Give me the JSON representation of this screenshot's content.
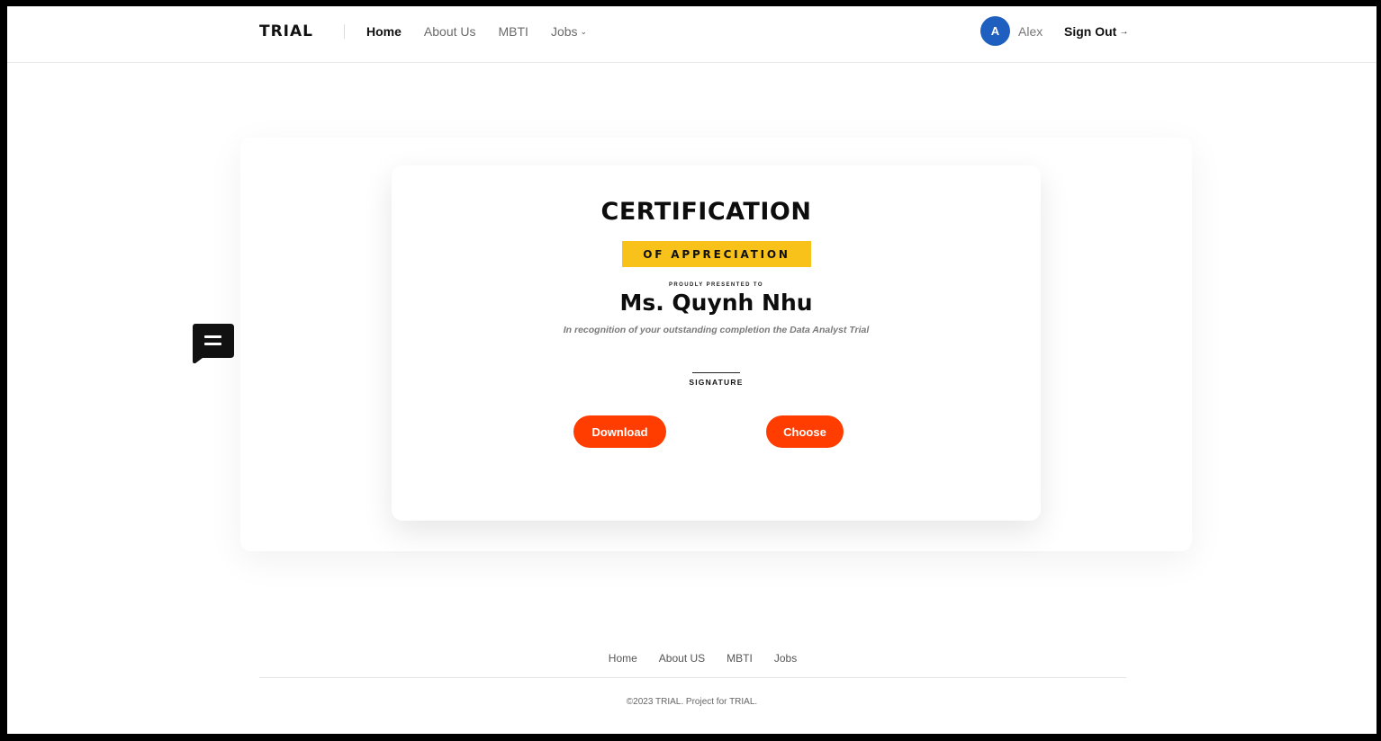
{
  "header": {
    "logo": "TRIAL",
    "nav": [
      {
        "label": "Home",
        "active": true
      },
      {
        "label": "About Us",
        "active": false
      },
      {
        "label": "MBTI",
        "active": false
      },
      {
        "label": "Jobs",
        "active": false,
        "dropdown": true
      }
    ],
    "user": {
      "avatar_initial": "A",
      "name": "Alex",
      "avatar_color": "#1f5fbf"
    },
    "sign_out_label": "Sign Out"
  },
  "certificate": {
    "title": "CERTIFICATION",
    "subtitle": "OF APPRECIATION",
    "presented_label": "PROUDLY PRESENTED TO",
    "recipient": "Ms. Quynh Nhu",
    "recognition": "In recognition of your outstanding completion the Data Analyst Trial",
    "signature_label": "SIGNATURE",
    "badge_color": "#f8c21a"
  },
  "actions": {
    "download_label": "Download",
    "choose_label": "Choose",
    "button_color": "#ff3d00"
  },
  "chat_widget": {
    "icon": "chat-icon"
  },
  "footer": {
    "links": [
      "Home",
      "About US",
      "MBTI",
      "Jobs"
    ],
    "copyright": "©2023 TRIAL. Project for TRIAL."
  }
}
